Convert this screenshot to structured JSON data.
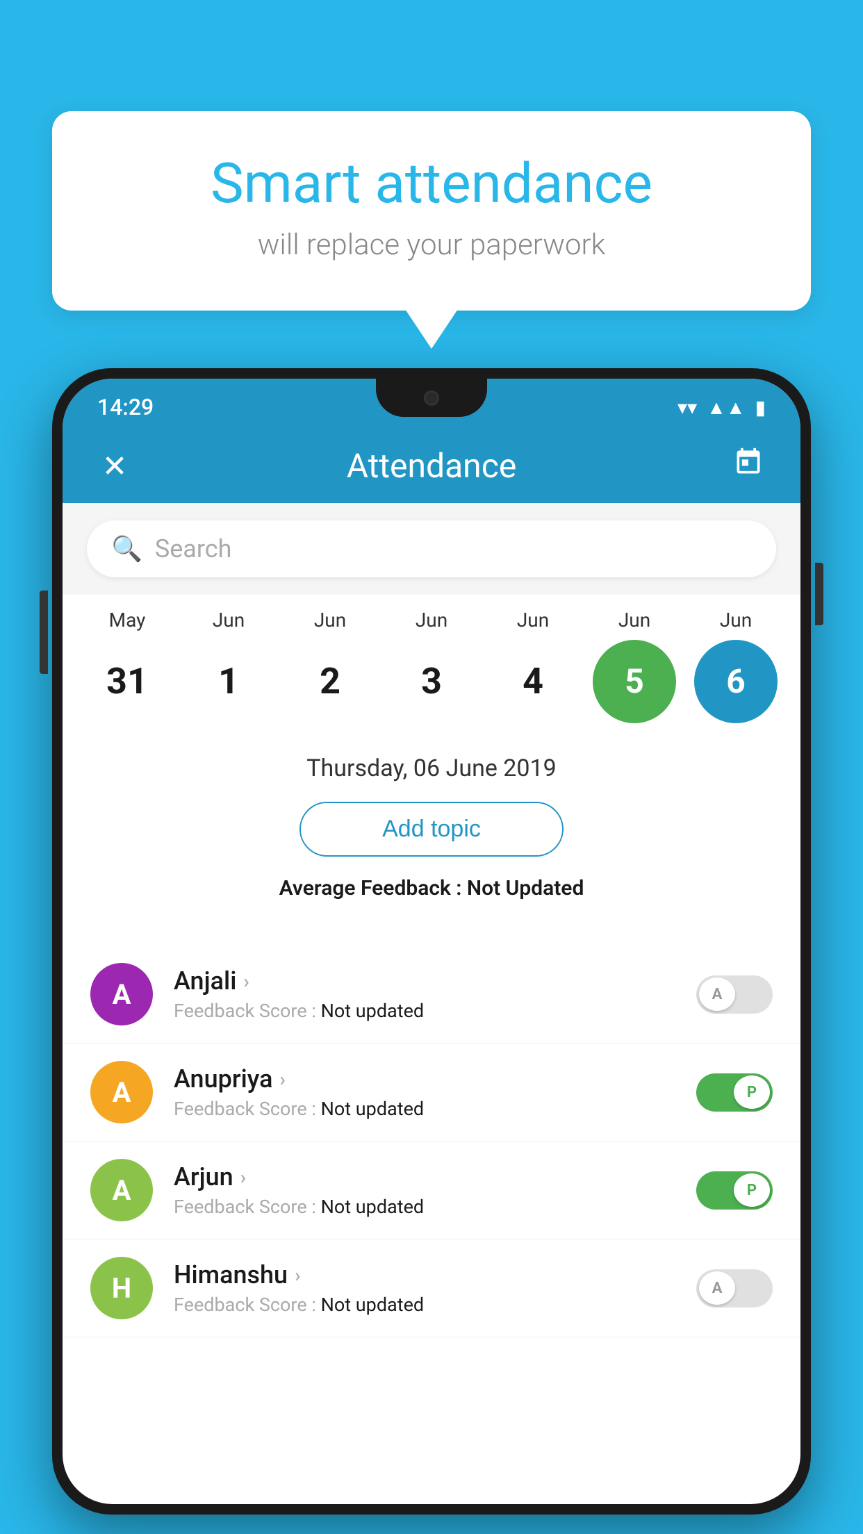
{
  "background_color": "#29b6e8",
  "speech_bubble": {
    "title": "Smart attendance",
    "subtitle": "will replace your paperwork"
  },
  "status_bar": {
    "time": "14:29",
    "wifi": "▼",
    "signal": "▲",
    "battery": "▮"
  },
  "app_bar": {
    "title": "Attendance",
    "close_label": "✕",
    "calendar_label": "📅"
  },
  "search": {
    "placeholder": "Search"
  },
  "calendar": {
    "months": [
      "May",
      "Jun",
      "Jun",
      "Jun",
      "Jun",
      "Jun",
      "Jun"
    ],
    "dates": [
      "31",
      "1",
      "2",
      "3",
      "4",
      "5",
      "6"
    ],
    "today_index": 5,
    "selected_index": 6
  },
  "selected_date": "Thursday, 06 June 2019",
  "add_topic_label": "Add topic",
  "avg_feedback": {
    "label": "Average Feedback : ",
    "value": "Not Updated"
  },
  "students": [
    {
      "name": "Anjali",
      "initial": "A",
      "avatar_color": "#9c27b0",
      "feedback": "Feedback Score : ",
      "feedback_value": "Not updated",
      "present": false
    },
    {
      "name": "Anupriya",
      "initial": "A",
      "avatar_color": "#f5a623",
      "feedback": "Feedback Score : ",
      "feedback_value": "Not updated",
      "present": true
    },
    {
      "name": "Arjun",
      "initial": "A",
      "avatar_color": "#8bc34a",
      "feedback": "Feedback Score : ",
      "feedback_value": "Not updated",
      "present": true
    },
    {
      "name": "Himanshu",
      "initial": "H",
      "avatar_color": "#8bc34a",
      "feedback": "Feedback Score : ",
      "feedback_value": "Not updated",
      "present": false
    }
  ]
}
